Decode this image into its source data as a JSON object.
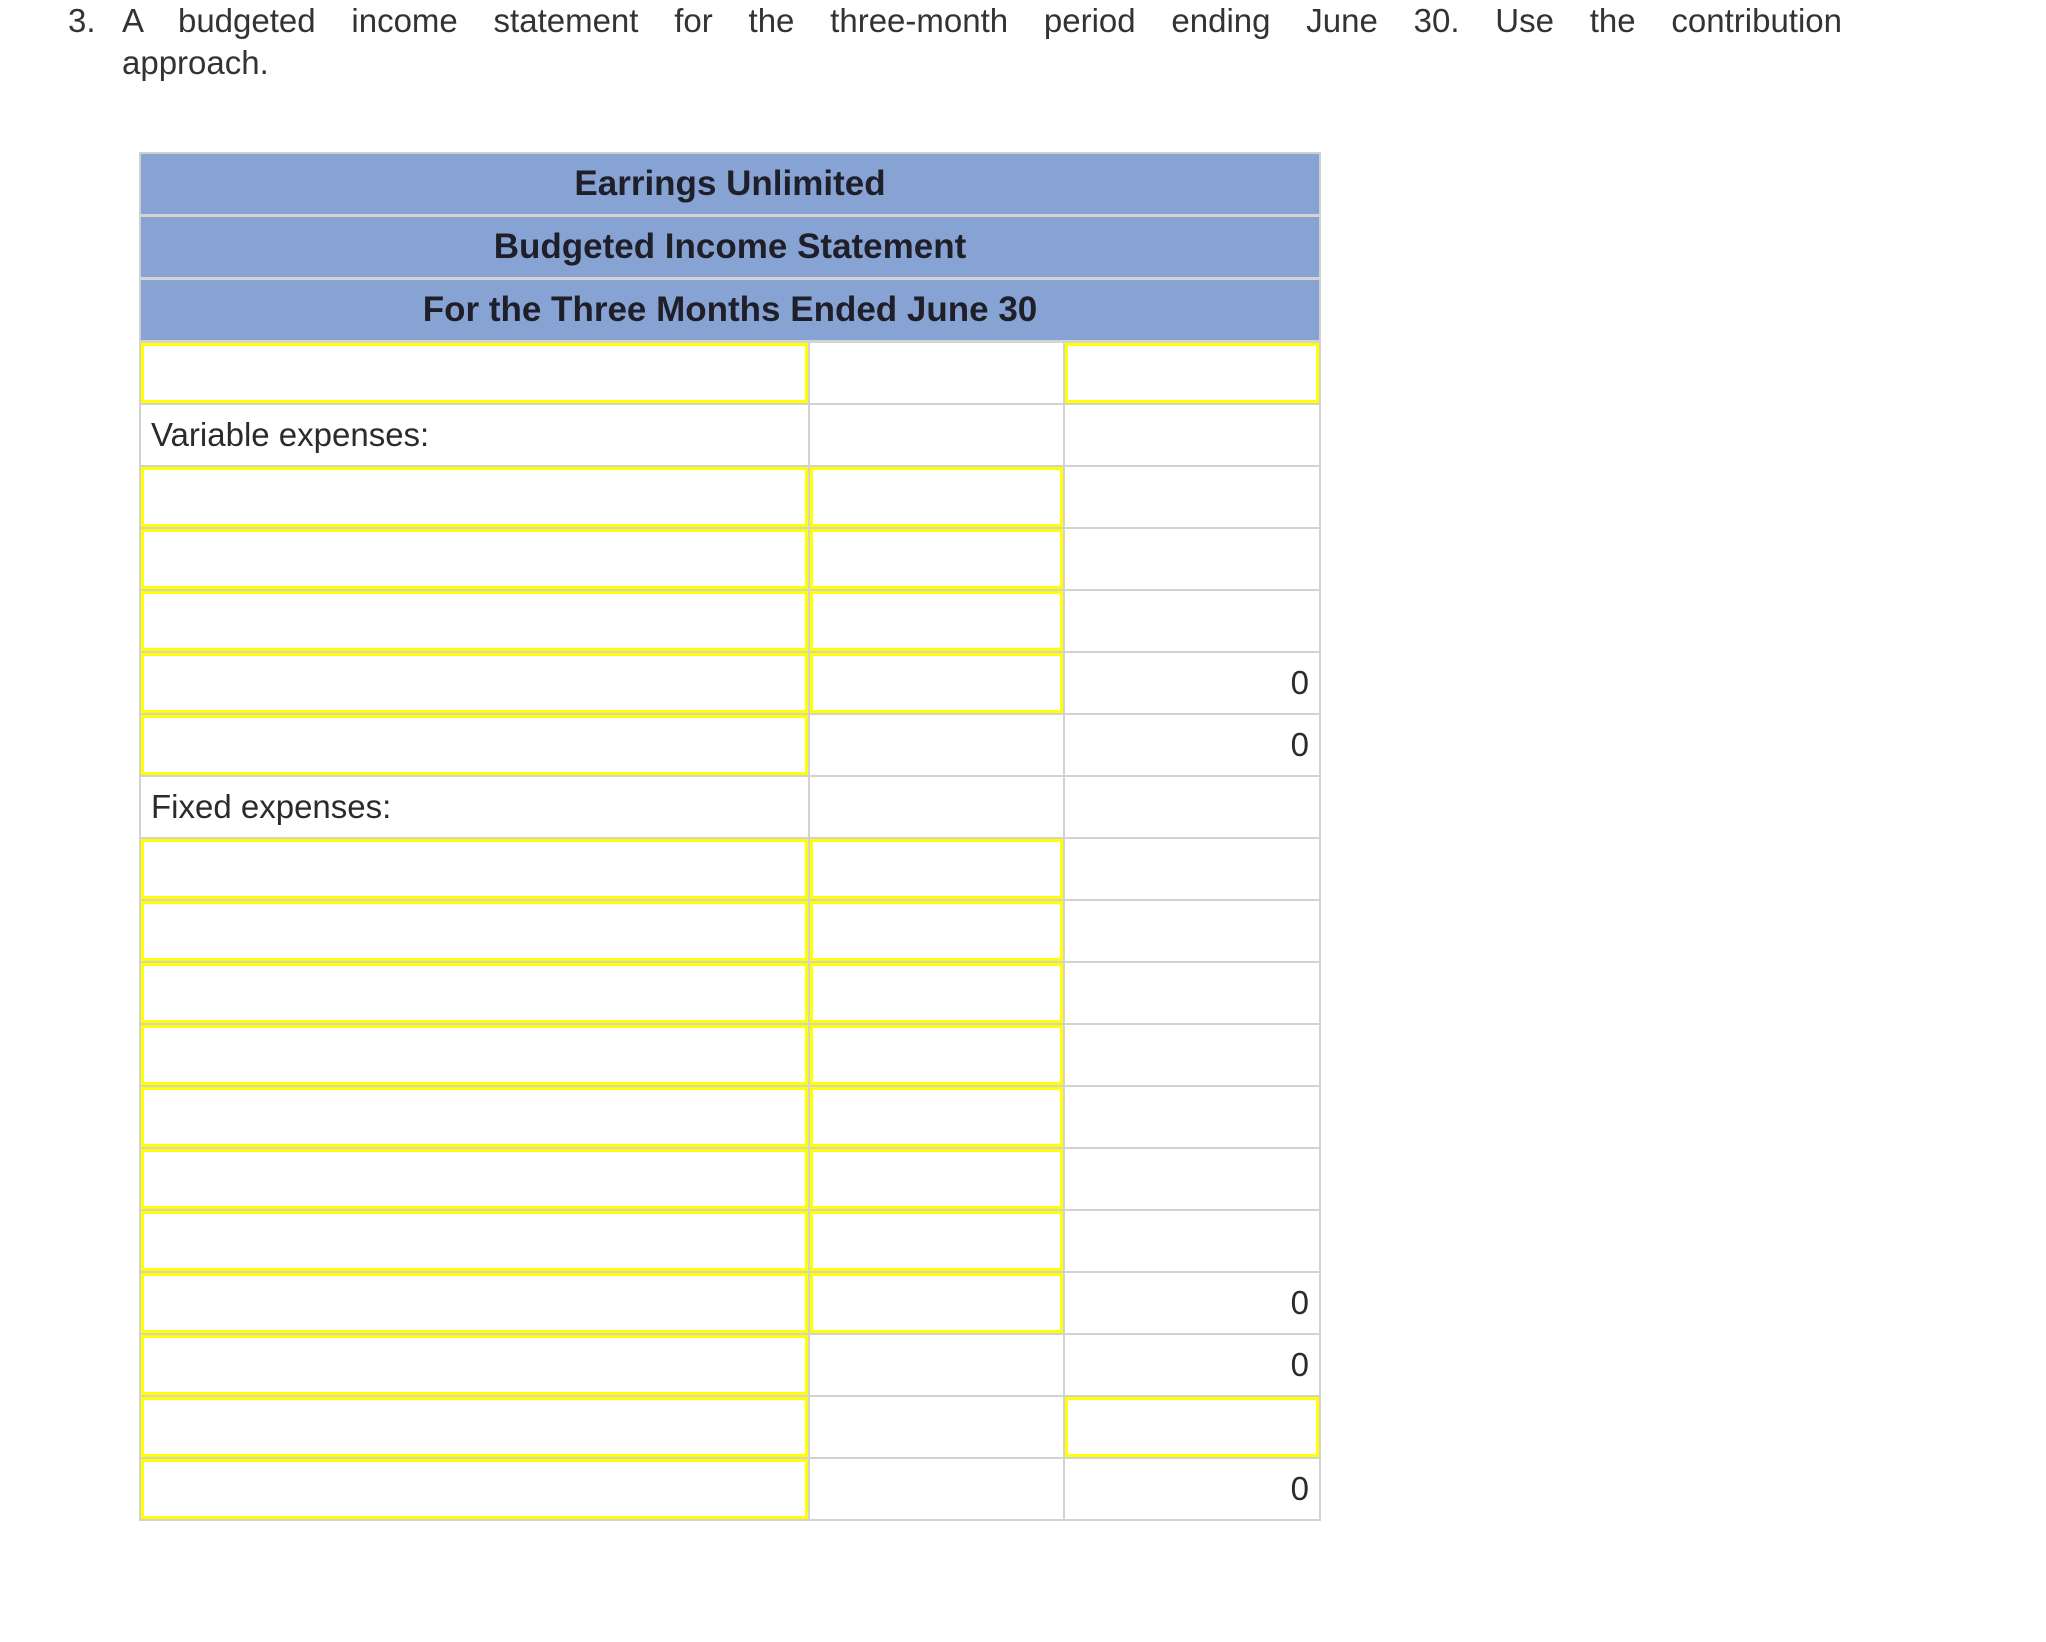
{
  "question": {
    "number": "3.",
    "line1": "A budgeted income statement for the three-month period ending June 30. Use the contribution",
    "line2": "approach."
  },
  "statement": {
    "company": "Earrings Unlimited",
    "title": "Budgeted Income Statement",
    "period": "For the Three Months Ended June 30",
    "colors": {
      "header_bg": "#87a3d3",
      "input_border": "#ffff00"
    },
    "rows": [
      {
        "c1": {
          "type": "input",
          "value": ""
        },
        "c2": {
          "type": "blank"
        },
        "c3": {
          "type": "input",
          "value": ""
        }
      },
      {
        "c1": {
          "type": "label",
          "text": "Variable expenses:"
        },
        "c2": {
          "type": "blank"
        },
        "c3": {
          "type": "blank"
        }
      },
      {
        "c1": {
          "type": "input",
          "value": ""
        },
        "c2": {
          "type": "input",
          "value": ""
        },
        "c3": {
          "type": "blank"
        }
      },
      {
        "c1": {
          "type": "input",
          "value": ""
        },
        "c2": {
          "type": "input",
          "value": ""
        },
        "c3": {
          "type": "blank"
        }
      },
      {
        "c1": {
          "type": "input",
          "value": ""
        },
        "c2": {
          "type": "input",
          "value": ""
        },
        "c3": {
          "type": "blank"
        }
      },
      {
        "c1": {
          "type": "input",
          "value": ""
        },
        "c2": {
          "type": "input",
          "value": "",
          "underline": "single"
        },
        "c3": {
          "type": "value",
          "text": "0",
          "underline": "single"
        }
      },
      {
        "c1": {
          "type": "input",
          "value": ""
        },
        "c2": {
          "type": "blank"
        },
        "c3": {
          "type": "value",
          "text": "0"
        }
      },
      {
        "c1": {
          "type": "label",
          "text": "Fixed expenses:"
        },
        "c2": {
          "type": "blank"
        },
        "c3": {
          "type": "blank"
        }
      },
      {
        "c1": {
          "type": "input",
          "value": ""
        },
        "c2": {
          "type": "input",
          "value": ""
        },
        "c3": {
          "type": "blank"
        }
      },
      {
        "c1": {
          "type": "input",
          "value": ""
        },
        "c2": {
          "type": "input",
          "value": ""
        },
        "c3": {
          "type": "blank"
        }
      },
      {
        "c1": {
          "type": "input",
          "value": ""
        },
        "c2": {
          "type": "input",
          "value": ""
        },
        "c3": {
          "type": "blank"
        }
      },
      {
        "c1": {
          "type": "input",
          "value": ""
        },
        "c2": {
          "type": "input",
          "value": ""
        },
        "c3": {
          "type": "blank"
        }
      },
      {
        "c1": {
          "type": "input",
          "value": ""
        },
        "c2": {
          "type": "input",
          "value": ""
        },
        "c3": {
          "type": "blank"
        }
      },
      {
        "c1": {
          "type": "input",
          "value": ""
        },
        "c2": {
          "type": "input",
          "value": ""
        },
        "c3": {
          "type": "blank"
        }
      },
      {
        "c1": {
          "type": "input",
          "value": ""
        },
        "c2": {
          "type": "input",
          "value": ""
        },
        "c3": {
          "type": "blank"
        }
      },
      {
        "c1": {
          "type": "input",
          "value": ""
        },
        "c2": {
          "type": "input",
          "value": "",
          "underline": "single"
        },
        "c3": {
          "type": "value",
          "text": "0",
          "underline": "single"
        }
      },
      {
        "c1": {
          "type": "input",
          "value": ""
        },
        "c2": {
          "type": "blank"
        },
        "c3": {
          "type": "value",
          "text": "0"
        }
      },
      {
        "c1": {
          "type": "input",
          "value": ""
        },
        "c2": {
          "type": "blank"
        },
        "c3": {
          "type": "input",
          "value": "",
          "underline": "single"
        }
      },
      {
        "c1": {
          "type": "input",
          "value": ""
        },
        "c2": {
          "type": "blank"
        },
        "c3": {
          "type": "value",
          "text": "0",
          "underline": "double"
        }
      }
    ]
  }
}
